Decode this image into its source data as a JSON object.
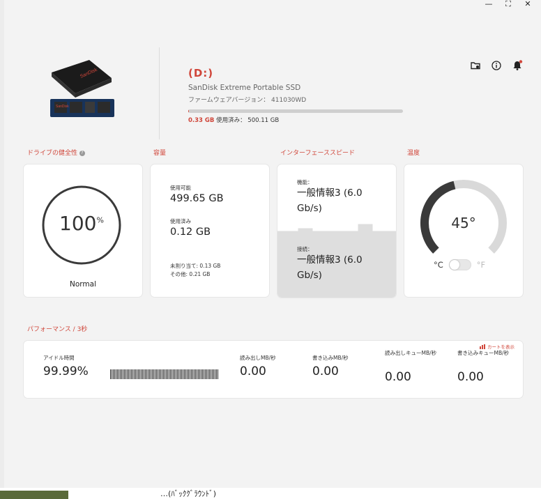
{
  "window": {
    "controls": {
      "minimize": "—",
      "maximize": "⛶",
      "close": "✕"
    }
  },
  "drive": {
    "letter": "(D:)",
    "name": "SanDisk Extreme Portable SSD",
    "firmware": "ファームウェアバージョン： 411030WD",
    "used": "0.33 GB",
    "used_suffix": " 使用済み：  500.11 GB",
    "used_fraction": 0.001
  },
  "icons": {
    "folder": "folder-settings-icon",
    "info": "info-icon",
    "bell": "bell-icon",
    "accent": "#d0463a"
  },
  "health": {
    "title": "ドライブの健全性",
    "value": "100",
    "unit": "%",
    "status": "Normal"
  },
  "capacity": {
    "title": "容量",
    "available_label": "使用可能",
    "available": "499.65 GB",
    "used_label": "使用済み",
    "used": "0.12 GB",
    "unallocated": "未割り当て: 0.13 GB",
    "other": "その他: 0.21 GB"
  },
  "interface": {
    "title": "インターフェーススピード",
    "capability_label": "機能：",
    "capability": "一般情報3 (6.0 Gb/s)",
    "connection_label": "接続：",
    "connection": "一般情報3 (6.0 Gb/s)"
  },
  "temperature": {
    "title": "温度",
    "value": "45°",
    "fraction": 0.45,
    "celsius": "°C",
    "fahrenheit": "°F"
  },
  "performance": {
    "title": "パフォーマンス / 3秒",
    "chart_link": "カートを表示",
    "idle_label": "アイドル時間",
    "idle": "99.99%",
    "read_label": "読み出しMB/秒",
    "read": "0.00",
    "write_label": "書き込みMB/秒",
    "write": "0.00",
    "read_queue_label": "読み出しキューMB/秒",
    "read_queue": "0.00",
    "write_queue_label": "書き込みキューMB/秒",
    "write_queue": "0.00"
  },
  "background_text": "…(ﾊﾞｯｸｸﾞﾗｳﾝﾄﾞ)"
}
